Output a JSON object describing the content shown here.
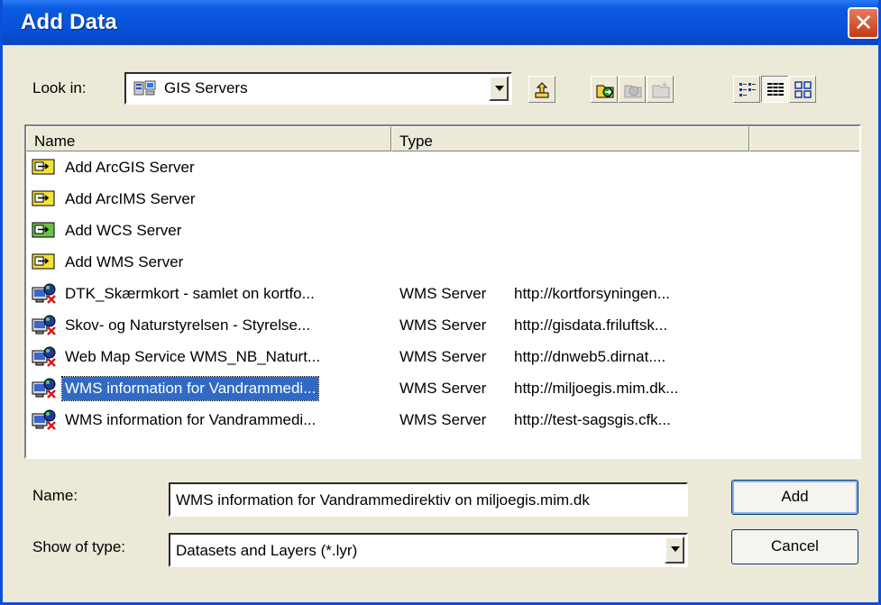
{
  "window": {
    "title": "Add Data",
    "close_glyph": "✕"
  },
  "toolbar": {
    "look_in_label": "Look in:",
    "look_in_value": "GIS Servers",
    "buttons": [
      "up-one-level-icon",
      "connect-to-folder-icon",
      "disconnect-folder-icon",
      "new-folder-icon",
      "list-view-icon",
      "details-view-icon",
      "thumbnails-view-icon"
    ]
  },
  "list": {
    "columns": [
      "Name",
      "Type",
      ""
    ],
    "rows": [
      {
        "name": "Add ArcGIS Server",
        "type": "",
        "url": "",
        "icon": "add-server-icon"
      },
      {
        "name": "Add ArcIMS Server",
        "type": "",
        "url": "",
        "icon": "add-server-icon"
      },
      {
        "name": "Add WCS Server",
        "type": "",
        "url": "",
        "icon": "add-wcs-server-icon"
      },
      {
        "name": "Add WMS Server",
        "type": "",
        "url": "",
        "icon": "add-server-icon"
      },
      {
        "name": "DTK_Skærmkort - samlet on kortfo...",
        "type": "WMS Server",
        "url": "http://kortforsyningen...",
        "icon": "wms-server-icon"
      },
      {
        "name": "Skov- og Naturstyrelsen - Styrelse...",
        "type": "WMS Server",
        "url": "http://gisdata.friluftsk...",
        "icon": "wms-server-icon"
      },
      {
        "name": "Web Map Service WMS_NB_Naturt...",
        "type": "WMS Server",
        "url": "http://dnweb5.dirnat....",
        "icon": "wms-server-icon"
      },
      {
        "name": "WMS information for Vandrammedi...",
        "type": "WMS Server",
        "url": "http://miljoegis.mim.dk...",
        "icon": "wms-server-icon",
        "selected": true
      },
      {
        "name": "WMS information for Vandrammedi...",
        "type": "WMS Server",
        "url": "http://test-sagsgis.cfk...",
        "icon": "wms-server-icon"
      }
    ]
  },
  "form": {
    "name_label": "Name:",
    "name_value": "WMS information for Vandrammedirektiv on miljoegis.mim.dk",
    "type_label": "Show of type:",
    "type_value": "Datasets and Layers (*.lyr)",
    "add_label": "Add",
    "cancel_label": "Cancel"
  }
}
